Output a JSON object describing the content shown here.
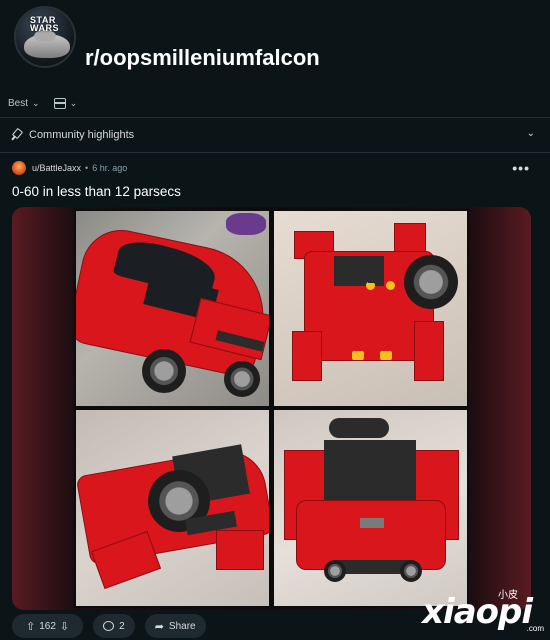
{
  "subreddit": {
    "name": "r/oopsmilleniumfalcon",
    "avatar_icon": "millennium-falcon-avatar",
    "avatar_logo_text": "STAR WARS"
  },
  "sort": {
    "selected": "Best",
    "view_icon": "layout-icon"
  },
  "highlights": {
    "label": "Community highlights"
  },
  "post": {
    "username": "u/BattleJaxx",
    "separator": "•",
    "time": "6 hr. ago",
    "more_label": "•••",
    "title": "0-60 in less than 12 parsecs",
    "images": [
      {
        "name": "lego-ferrari-front"
      },
      {
        "name": "lego-ferrari-transformed-top"
      },
      {
        "name": "lego-ferrari-side-wheel"
      },
      {
        "name": "lego-ferrari-rear"
      }
    ],
    "votes": "162",
    "comments": "2",
    "share_label": "Share"
  },
  "watermark": {
    "small": "小皮",
    "big": "xiaopi",
    "domain": ".com"
  },
  "colors": {
    "background": "#0b1416",
    "pill": "#1f2a30",
    "accent_red": "#d8161c"
  }
}
